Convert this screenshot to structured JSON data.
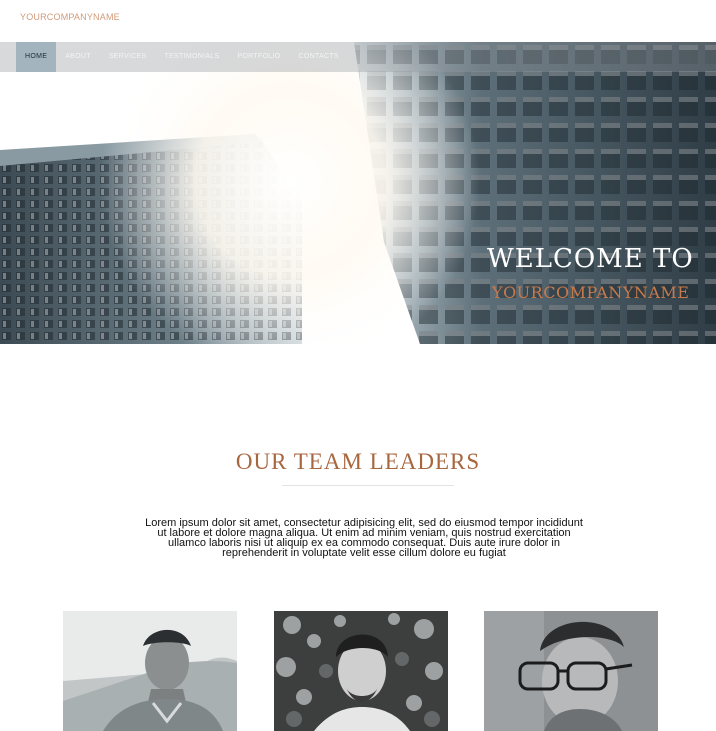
{
  "logo": "YOURCOMPANYNAME",
  "nav": [
    {
      "label": "HOME"
    },
    {
      "label": "ABOUT"
    },
    {
      "label": "SERVICES"
    },
    {
      "label": "TESTIMONIALS"
    },
    {
      "label": "PORTFOLIO"
    },
    {
      "label": "CONTACTS"
    }
  ],
  "hero": {
    "welcome": "WELCOME TO",
    "company": "YOURCOMPANYNAME"
  },
  "team": {
    "title": "OUR TEAM LEADERS",
    "description": "Lorem ipsum dolor sit amet, consectetur adipisicing elit, sed do eiusmod tempor incididunt ut labore et dolore magna aliqua. Ut enim ad minim veniam, quis nostrud exercitation ullamco laboris nisi ut aliquip ex ea commodo consequat. Duis aute irure dolor in reprehenderit in voluptate velit esse cillum dolore eu fugiat"
  },
  "colors": {
    "accent": "#a8663f",
    "logo": "#d19a79",
    "welcome_sub": "#c97a4a"
  }
}
